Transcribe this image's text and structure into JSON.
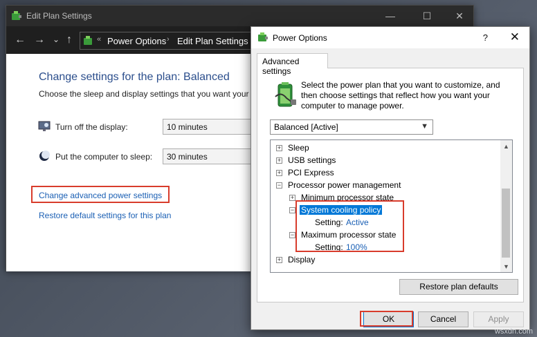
{
  "background_window": {
    "title": "Edit Plan Settings",
    "controls": {
      "minimize": "—",
      "maximize": "☐",
      "close": "✕"
    },
    "nav": {
      "back": "←",
      "forward": "→",
      "recent": "⌄",
      "up": "↑"
    },
    "address": {
      "separator": "«",
      "crumb1": "Power Options",
      "crumb_sep": "›",
      "crumb2": "Edit Plan Settings"
    },
    "heading": "Change settings for the plan: Balanced",
    "description": "Choose the sleep and display settings that you want your c",
    "display_label": "Turn off the display:",
    "display_value": "10 minutes",
    "sleep_label": "Put the computer to sleep:",
    "sleep_value": "30 minutes",
    "advanced_link": "Change advanced power settings",
    "restore_link": "Restore default settings for this plan"
  },
  "dialog": {
    "title": "Power Options",
    "help": "?",
    "close": "✕",
    "tab": "Advanced settings",
    "intro": "Select the power plan that you want to customize, and then choose settings that reflect how you want your computer to manage power.",
    "plan_selected": "Balanced [Active]",
    "tree": [
      {
        "level": 0,
        "expander": "+",
        "label": "Sleep"
      },
      {
        "level": 0,
        "expander": "+",
        "label": "USB settings"
      },
      {
        "level": 0,
        "expander": "+",
        "label": "PCI Express"
      },
      {
        "level": 0,
        "expander": "−",
        "label": "Processor power management"
      },
      {
        "level": 1,
        "expander": "+",
        "label": "Minimum processor state"
      },
      {
        "level": 1,
        "expander": "−",
        "label": "System cooling policy",
        "selected": true
      },
      {
        "level": 2,
        "label": "Setting:",
        "value": "Active"
      },
      {
        "level": 1,
        "expander": "−",
        "label": "Maximum processor state"
      },
      {
        "level": 2,
        "label": "Setting:",
        "value": "100%"
      },
      {
        "level": 0,
        "expander": "+",
        "label": "Display"
      }
    ],
    "restore_button": "Restore plan defaults",
    "ok_button": "OK",
    "cancel_button": "Cancel",
    "apply_button": "Apply"
  },
  "watermark": "wsxdn.com",
  "colors": {
    "highlight_border": "#d83b2b",
    "link": "#1a5fb4",
    "selection": "#0078d7"
  }
}
